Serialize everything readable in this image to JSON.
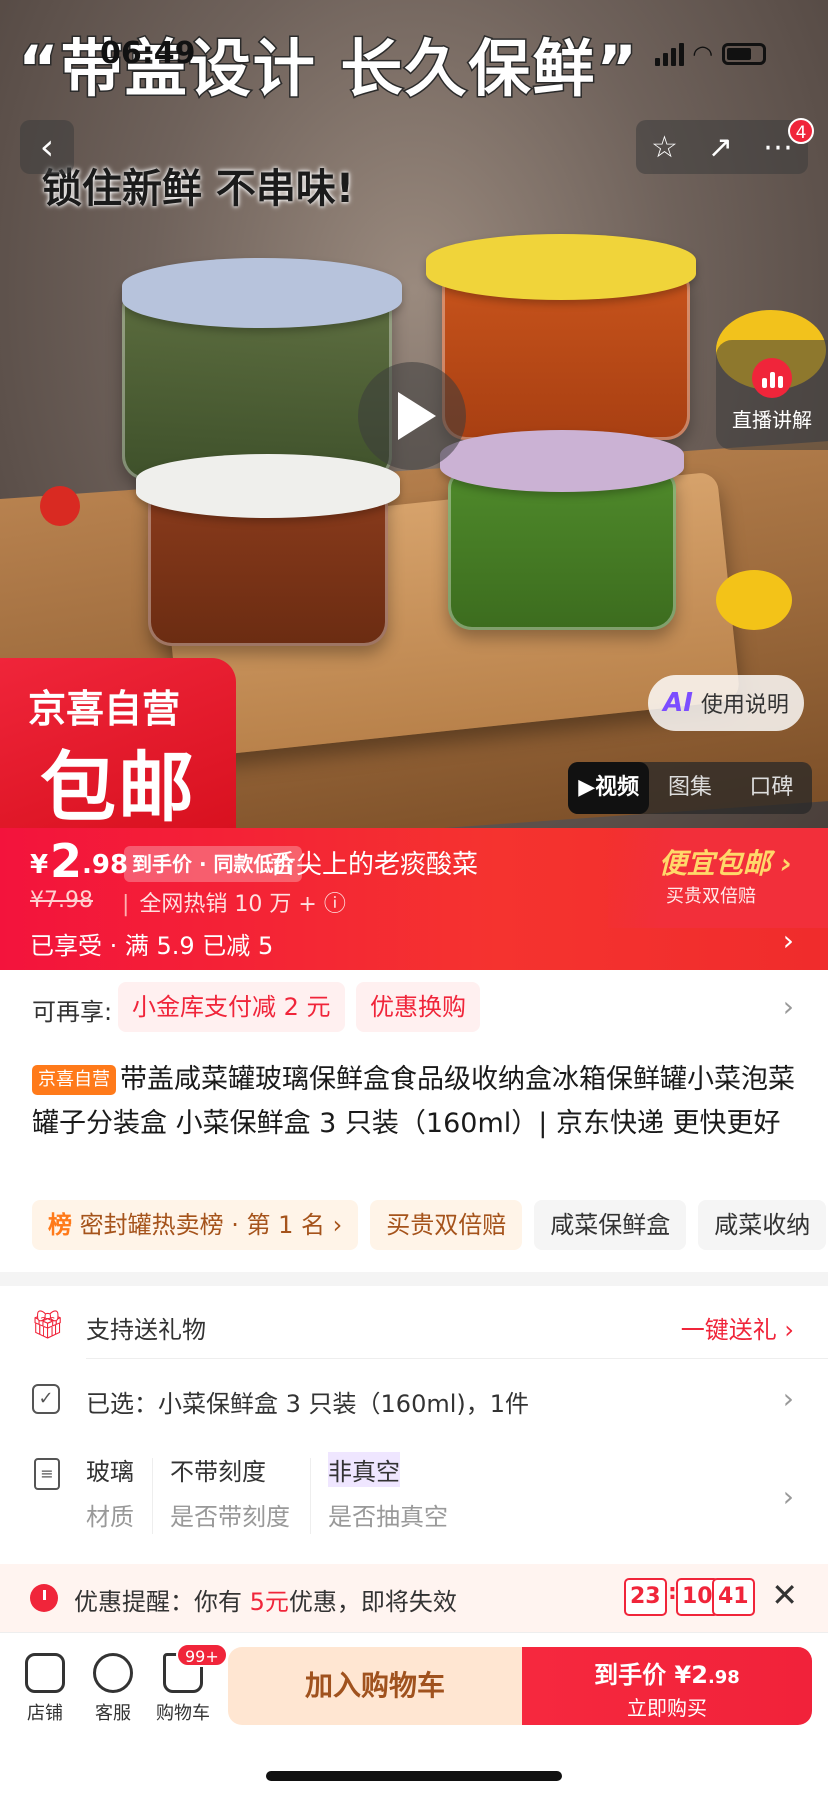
{
  "status": {
    "time": "06:49"
  },
  "hero": {
    "headline": "“带盖设计 长久保鲜”",
    "subline": "锁住新鲜 不串味!",
    "notif_count": "4",
    "live_label": "直播讲解",
    "badge_line1": "京喜自营",
    "badge_line2": "包邮",
    "ai_label": "使用说明",
    "media_tabs": [
      "▶视频",
      "图集",
      "口碑"
    ]
  },
  "price": {
    "currency": "¥",
    "int": "2",
    "dec": ".98",
    "tag": "到手价 · 同款低价",
    "product_nickname": "舌尖上的老痰酸菜",
    "original": "¥7.98",
    "hot_sales": "全网热销 10 万 +",
    "enjoyed": "已享受 · 满 5.9 已减 5",
    "promo_title": "便宜包邮 ›",
    "promo_sub": "买贵双倍赔"
  },
  "offers": {
    "label": "可再享:",
    "chips": [
      "小金库支付减 2 元",
      "优惠换购"
    ]
  },
  "product": {
    "badge": "京喜自营",
    "title": "带盖咸菜罐玻璃保鲜盒食品级收纳盒冰箱保鲜罐小菜泡菜罐子分装盒 小菜保鲜盒 3 只装（160ml）| 京东快递 更快更好"
  },
  "tags": {
    "rank_icon": "榜",
    "rank": "密封罐热卖榜 · 第 1 名 ›",
    "items": [
      "买贵双倍赔",
      "咸菜保鲜盒",
      "咸菜收纳"
    ]
  },
  "rows": {
    "gift": "支持送礼物",
    "gift_action": "一键送礼 ›",
    "selected": "已选：小菜保鲜盒 3 只装（160ml)，1件",
    "specs": [
      {
        "value": "玻璃",
        "label": "材质"
      },
      {
        "value": "不带刻度",
        "label": "是否带刻度"
      },
      {
        "value": "非真空",
        "label": "是否抽真空"
      }
    ]
  },
  "reminder": {
    "prefix": "优惠提醒：你有 ",
    "amount": "5元",
    "suffix": "优惠，即将失效",
    "hh": "23",
    "mm": "10",
    "ss": "41"
  },
  "bottom": {
    "store": "店铺",
    "service": "客服",
    "cart": "购物车",
    "cart_count": "99+",
    "add_cart": "加入购物车",
    "buy_price_label": "到手价 ",
    "buy_price": "¥2",
    "buy_price_dec": ".98",
    "buy_now": "立即购买"
  }
}
